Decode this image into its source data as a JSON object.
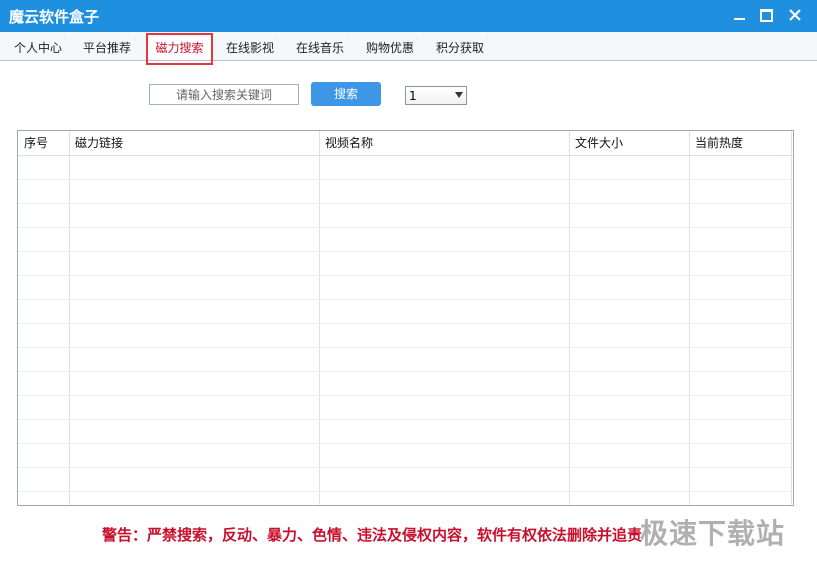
{
  "window": {
    "title": "魔云软件盒子"
  },
  "tabs": [
    {
      "label": "个人中心"
    },
    {
      "label": "平台推荐"
    },
    {
      "label": "磁力搜索"
    },
    {
      "label": "在线影视"
    },
    {
      "label": "在线音乐"
    },
    {
      "label": "购物优惠"
    },
    {
      "label": "积分获取"
    }
  ],
  "search": {
    "placeholder": "请输入搜索关键词",
    "button": "搜索",
    "page_select": "1"
  },
  "table": {
    "columns": [
      "序号",
      "磁力链接",
      "视频名称",
      "文件大小",
      "当前热度"
    ]
  },
  "warning": "警告：严禁搜索，反动、暴力、色情、违法及侵权内容，软件有权依法删除并追责",
  "watermark": "极速下载站",
  "colors": {
    "titlebar": "#1f8fe0",
    "accent": "#3d96e6",
    "warning": "#c8102e",
    "highlight": "#e23a3a"
  }
}
